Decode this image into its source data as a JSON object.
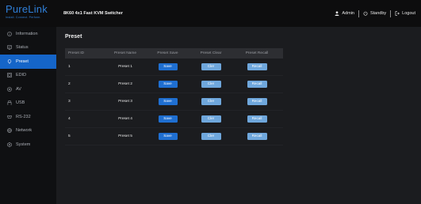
{
  "brand": {
    "name": "PureLink",
    "tagline": "Install. Connect. Perform."
  },
  "header": {
    "device_title": "8K60 4x1 Fast KVM Switcher",
    "user_label": "Admin",
    "standby_label": "Standby",
    "logout_label": "Logout"
  },
  "sidebar": {
    "items": [
      {
        "label": "Information",
        "icon": "info-icon"
      },
      {
        "label": "Status",
        "icon": "status-monitor-icon"
      },
      {
        "label": "Preset",
        "icon": "preset-icon",
        "active": true
      },
      {
        "label": "EDID",
        "icon": "edid-icon"
      },
      {
        "label": "AV",
        "icon": "av-icon"
      },
      {
        "label": "USB",
        "icon": "usb-icon"
      },
      {
        "label": "RS-232",
        "icon": "rs232-icon"
      },
      {
        "label": "Network",
        "icon": "network-icon"
      },
      {
        "label": "System",
        "icon": "system-gear-icon"
      }
    ]
  },
  "main": {
    "title": "Preset",
    "columns": [
      "Preset ID",
      "Preset Name",
      "Preset Save",
      "Preset Clear",
      "Preset Recall"
    ],
    "rows": [
      {
        "id": "1",
        "name": "Preset 1",
        "save": "Save",
        "clear": "Cler",
        "recall": "Recall"
      },
      {
        "id": "2",
        "name": "Preset 2",
        "save": "Save",
        "clear": "Cler",
        "recall": "Recall"
      },
      {
        "id": "3",
        "name": "Preset 3",
        "save": "Save",
        "clear": "Cler",
        "recall": "Recall"
      },
      {
        "id": "4",
        "name": "Preset 4",
        "save": "Save",
        "clear": "Cler",
        "recall": "Recall"
      },
      {
        "id": "5",
        "name": "Preset 5",
        "save": "Save",
        "clear": "Cler",
        "recall": "Recall"
      }
    ]
  },
  "colors": {
    "accent": "#1565c8",
    "save_button": "#1f6fd1",
    "secondary_button": "#6fa7dc",
    "brand": "#2f7fd8"
  }
}
